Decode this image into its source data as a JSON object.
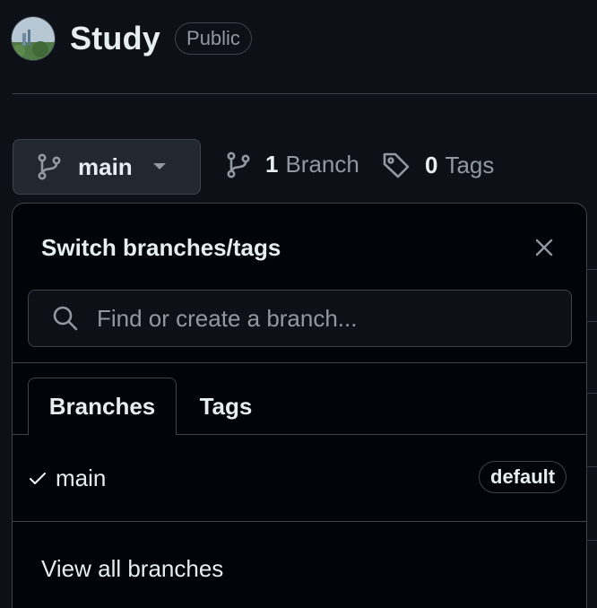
{
  "repo": {
    "name": "Study",
    "visibility": "Public"
  },
  "branch_bar": {
    "current_branch": "main",
    "branches_count": "1",
    "branches_label": "Branch",
    "tags_count": "0",
    "tags_label": "Tags"
  },
  "popover": {
    "title": "Switch branches/tags",
    "search": {
      "value": "",
      "placeholder": "Find or create a branch..."
    },
    "tabs": [
      {
        "label": "Branches",
        "active": true
      },
      {
        "label": "Tags",
        "active": false
      }
    ],
    "branches": [
      {
        "name": "main",
        "selected": true,
        "badge": "default"
      }
    ],
    "view_all_label": "View all branches"
  },
  "colors": {
    "background": "#0d1117",
    "popover_background": "#010409",
    "border": "#3d444d",
    "text_primary": "#e6edf3",
    "text_muted": "#9198a1",
    "button_background": "#212830"
  },
  "icons": {
    "branch_button": "git-branch-icon",
    "caret": "triangle-down-icon",
    "branch_count": "git-branch-icon",
    "tags": "tag-icon",
    "close": "x-icon",
    "search": "search-icon",
    "selected": "check-icon"
  }
}
